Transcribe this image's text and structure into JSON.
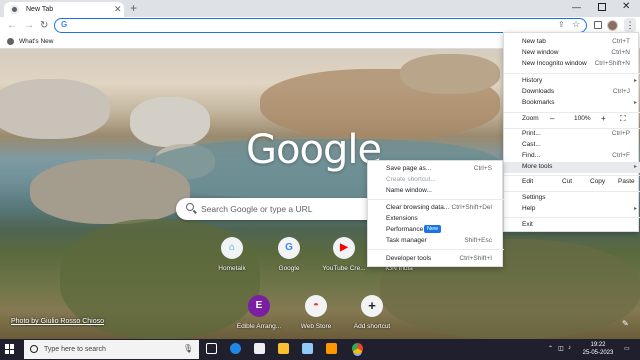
{
  "tab": {
    "title": "New Tab"
  },
  "bookmarks": {
    "whats_new": "What's New"
  },
  "ntp": {
    "logo": "Google",
    "search_placeholder": "Search Google or type a URL",
    "shortcuts_row1": [
      {
        "label": "Hometalk",
        "glyph": "⌂",
        "color": "#1a9edb"
      },
      {
        "label": "Google",
        "glyph": "G",
        "color": "#4285f4"
      },
      {
        "label": "YouTube Cre...",
        "glyph": "▶",
        "color": "#ff0000"
      },
      {
        "label": "IGN India",
        "glyph": "",
        "color": "#d32f2f"
      }
    ],
    "shortcuts_row2": [
      {
        "label": "Edible Arrang...",
        "glyph": "E",
        "color": "#7b1fa2"
      },
      {
        "label": "Web Store",
        "glyph": "◓",
        "color": "#e53935"
      },
      {
        "label": "Add shortcut",
        "glyph": "+",
        "color": "#202124"
      }
    ],
    "photo_credit": "Photo by Giulio Rosso Chioso"
  },
  "menu": {
    "items_top": [
      {
        "label": "New tab",
        "shortcut": "Ctrl+T"
      },
      {
        "label": "New window",
        "shortcut": "Ctrl+N"
      },
      {
        "label": "New Incognito window",
        "shortcut": "Ctrl+Shift+N"
      }
    ],
    "items_mid": [
      {
        "label": "History",
        "shortcut": ""
      },
      {
        "label": "Downloads",
        "shortcut": "Ctrl+J"
      },
      {
        "label": "Bookmarks",
        "shortcut": ""
      }
    ],
    "zoom_label": "Zoom",
    "zoom_minus": "–",
    "zoom_value": "100%",
    "zoom_plus": "+",
    "items_tools": [
      {
        "label": "Print...",
        "shortcut": "Ctrl+P"
      },
      {
        "label": "Cast...",
        "shortcut": ""
      },
      {
        "label": "Find...",
        "shortcut": "Ctrl+F"
      },
      {
        "label": "More tools",
        "shortcut": ""
      }
    ],
    "edit_label": "Edit",
    "cut": "Cut",
    "copy": "Copy",
    "paste": "Paste",
    "items_bottom": [
      {
        "label": "Settings",
        "shortcut": ""
      },
      {
        "label": "Help",
        "shortcut": ""
      }
    ],
    "exit": "Exit"
  },
  "submenu": {
    "items": [
      {
        "label": "Save page as...",
        "shortcut": "Ctrl+S",
        "disabled": false
      },
      {
        "label": "Create shortcut...",
        "shortcut": "",
        "disabled": true
      },
      {
        "label": "Name window...",
        "shortcut": "",
        "disabled": false
      },
      {
        "label": "Clear browsing data...",
        "shortcut": "Ctrl+Shift+Del",
        "disabled": false
      },
      {
        "label": "Extensions",
        "shortcut": "",
        "disabled": false
      },
      {
        "label": "Performance",
        "shortcut": "",
        "disabled": false
      },
      {
        "label": "Task manager",
        "shortcut": "Shift+Esc",
        "disabled": false
      },
      {
        "label": "Developer tools",
        "shortcut": "Ctrl+Shift+I",
        "disabled": false
      }
    ],
    "new_badge": "New"
  },
  "taskbar": {
    "search_placeholder": "Type here to search",
    "time": "19:22",
    "date": "25-05-2023"
  }
}
